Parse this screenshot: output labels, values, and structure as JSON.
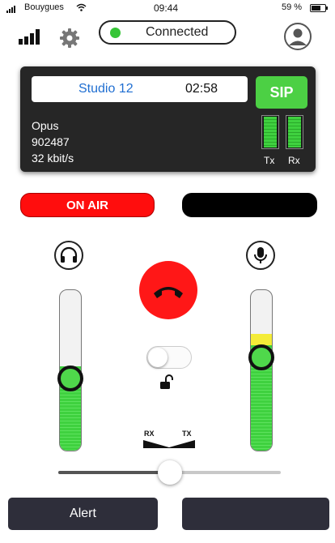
{
  "status_bar": {
    "carrier": "Bouygues",
    "time": "09:44",
    "battery": "59 %"
  },
  "toolbar": {
    "connection_status": "Connected",
    "connection_color": "#36c537",
    "icons": [
      "network-stats-icon",
      "gear-icon",
      "user-account-icon"
    ]
  },
  "session": {
    "studio_name": "Studio 12",
    "timer": "02:58",
    "protocol_button": "SIP",
    "codec": "Opus",
    "id": "902487",
    "bitrate": "32 kbit/s",
    "meters": {
      "tx_label": "Tx",
      "rx_label": "Rx",
      "tx_level": 0.95,
      "rx_level": 0.95
    }
  },
  "on_air": {
    "label": "ON AIR",
    "color": "#ff0d0d"
  },
  "audio": {
    "headphone_level": 0.52,
    "mic_level": 0.65,
    "hangup_color": "#ff1717",
    "lock_toggle_on": false,
    "balance_rx_label": "RX",
    "balance_tx_label": "TX",
    "master_level": 0.5
  },
  "bottom": {
    "alert_label": "Alert",
    "second_label": ""
  }
}
